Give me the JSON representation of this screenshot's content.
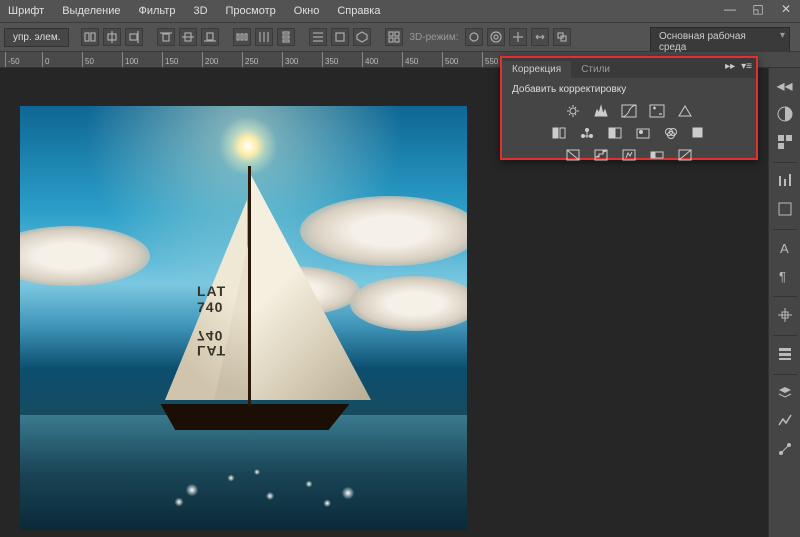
{
  "menu": {
    "items": [
      "Шрифт",
      "Выделение",
      "Фильтр",
      "3D",
      "Просмотр",
      "Окно",
      "Справка"
    ]
  },
  "options": {
    "label": "упр. элем.",
    "mode3d": "3D-режим:"
  },
  "workspace": {
    "selected": "Основная рабочая среда"
  },
  "ruler": {
    "marks": [
      "-50",
      "0",
      "50",
      "100",
      "150",
      "200",
      "250",
      "300",
      "350",
      "400",
      "450",
      "500",
      "550"
    ]
  },
  "panel": {
    "tabs": [
      "Коррекция",
      "Стили"
    ],
    "collapse": "▸▸",
    "title": "Добавить корректировку",
    "rows": [
      [
        "brightness",
        "levels",
        "curves",
        "exposure",
        "vibrance"
      ],
      [
        "hue-sat",
        "color-balance",
        "bw",
        "photo-filter",
        "channel-mixer",
        "lut"
      ],
      [
        "invert",
        "posterize",
        "threshold",
        "gradient-map",
        "selective-color"
      ]
    ]
  },
  "image": {
    "sail_reg": "LAT\n740"
  },
  "dock": {
    "items": [
      "history",
      "adjustments",
      "properties",
      "character",
      "paragraph",
      "brushes",
      "swatches",
      "layers",
      "channels",
      "paths"
    ]
  }
}
